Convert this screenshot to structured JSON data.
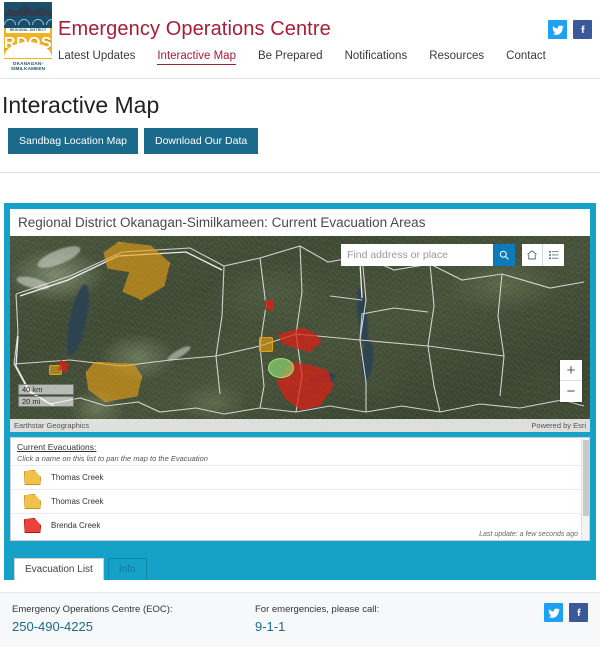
{
  "header": {
    "logo": {
      "top_text": "REGIONAL DISTRICT",
      "acronym": "RDOS",
      "region_line1": "OKANAGAN-",
      "region_line2": "SIMILKAMEEN"
    },
    "brand_title": "Emergency Operations Centre",
    "social": [
      {
        "name": "twitter-icon",
        "label": "Twitter"
      },
      {
        "name": "facebook-icon",
        "label": "Facebook"
      }
    ],
    "nav": [
      {
        "label": "Latest Updates",
        "active": false
      },
      {
        "label": "Interactive Map",
        "active": true
      },
      {
        "label": "Be Prepared",
        "active": false
      },
      {
        "label": "Notifications",
        "active": false
      },
      {
        "label": "Resources",
        "active": false
      },
      {
        "label": "Contact",
        "active": false
      }
    ]
  },
  "page": {
    "title": "Interactive Map",
    "buttons": [
      {
        "label": "Sandbag Location Map"
      },
      {
        "label": "Download Our Data"
      }
    ]
  },
  "map": {
    "title": "Regional District Okanagan-Similkameen: Current Evacuation Areas",
    "search": {
      "placeholder": "Find address or place",
      "value": "",
      "search_icon": "search-icon"
    },
    "tools": [
      {
        "name": "home-icon",
        "label": "Default extent"
      },
      {
        "name": "legend-icon",
        "label": "Legend"
      }
    ],
    "zoom": {
      "in_label": "+",
      "out_label": "−"
    },
    "scale": {
      "km": "40 km",
      "mi": "20 mi"
    },
    "attribution_left": "Earthstar Geographics",
    "attribution_right": "Powered by Esri"
  },
  "evac_panel": {
    "heading": "Current Evacuations:",
    "instruction": "Click a name on this list to pan the map to the Evacuation",
    "rows": [
      {
        "label": "Thomas Creek",
        "type": "alert"
      },
      {
        "label": "Thomas Creek",
        "type": "alert"
      },
      {
        "label": "Brenda Creek",
        "type": "order"
      }
    ],
    "last_update": "Last update: a few seconds ago",
    "tabs": [
      {
        "label": "Evacuation List",
        "active": true
      },
      {
        "label": "Info",
        "active": false
      }
    ]
  },
  "footer": {
    "eoc_label": "Emergency Operations Centre (EOC):",
    "eoc_phone": "250-490-4225",
    "emergency_label": "For emergencies, please call:",
    "emergency_phone": "9-1-1",
    "social": [
      {
        "name": "twitter-icon",
        "label": "Twitter"
      },
      {
        "name": "facebook-icon",
        "label": "Facebook"
      }
    ]
  },
  "colors": {
    "brand_red": "#A81C38",
    "button_blue": "#1A6A8C",
    "widget_teal": "#16A2C8",
    "logo_gold": "#F0B323",
    "evac_alert": "#E6A014",
    "evac_order": "#D42018",
    "twitter": "#1DA1F2",
    "facebook": "#3B5998"
  }
}
